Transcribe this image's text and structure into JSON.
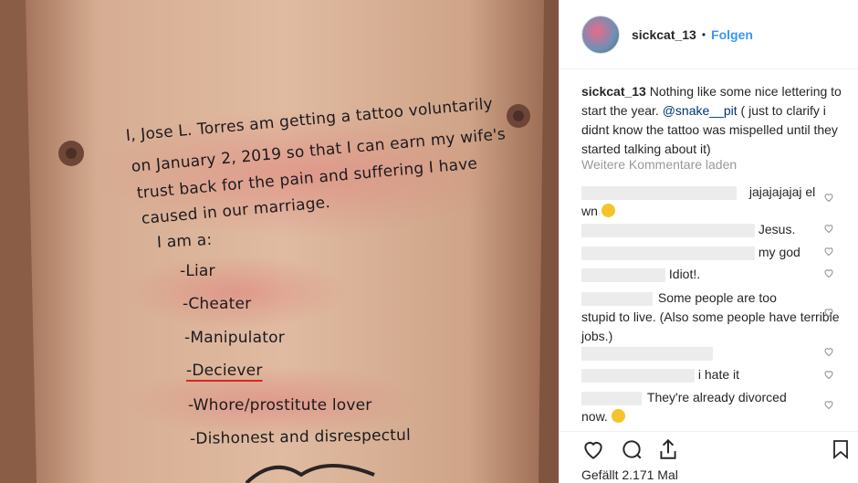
{
  "photo": {
    "tattoo_lines": [
      "I, Jose L. Torres  am getting a tattoo voluntarily",
      "on January 2, 2019 so that I can earn my wife's",
      "trust back for the pain and suffering I have",
      "caused in our marriage.",
      "I am a:",
      "-Liar",
      "-Cheater",
      "-Manipulator",
      "-Deciever",
      "-Whore/prostitute lover",
      "-Dishonest and disrespectul"
    ]
  },
  "header": {
    "username": "sickcat_13",
    "dot": "•",
    "follow_label": "Folgen"
  },
  "caption": {
    "username": "sickcat_13",
    "text_before": " Nothing like some nice lettering to start the year. ",
    "mention": "@snake__pit",
    "text_after": " ( just to clarify i didnt know the tattoo was mispelled until they started talking about it)"
  },
  "load_more_label": "Weitere Kommentare laden",
  "comments": [
    {
      "text": "jajajajajaj el",
      "text2": "wn",
      "emoji": "grin-emoji"
    },
    {
      "text": "Jesus."
    },
    {
      "text": "my god"
    },
    {
      "text": "Idiot!."
    },
    {
      "text": "Some people are too",
      "text2": "stupid to live. (Also some people have terrible jobs.)"
    },
    {
      "text": ""
    },
    {
      "text": "i hate it"
    },
    {
      "text": "They're already divorced",
      "text2": "now.",
      "emoji": "sunglasses-emoji"
    }
  ],
  "likes_label": "Gefällt 2.171 Mal",
  "icons": [
    "heart-icon",
    "comment-icon",
    "share-icon",
    "bookmark-icon"
  ],
  "colors": {
    "link": "#3897f0",
    "mention": "#003569",
    "muted": "#999999",
    "underline": "#d12a22"
  }
}
